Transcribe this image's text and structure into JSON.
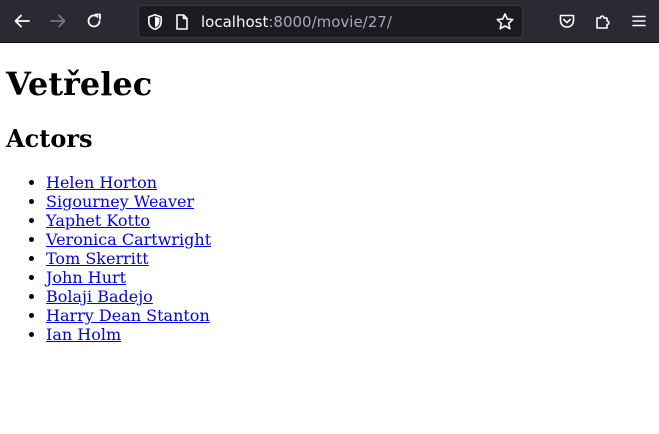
{
  "browser": {
    "url": {
      "host": "localhost",
      "path": ":8000/movie/27/"
    },
    "icons": {
      "back": "arrow-left-icon",
      "forward": "arrow-right-icon",
      "reload": "reload-icon",
      "tracking_protection": "shield-icon",
      "page_info": "page-icon",
      "bookmark": "star-icon",
      "pocket": "pocket-icon",
      "extensions": "puzzle-icon",
      "menu": "hamburger-menu-icon"
    },
    "colors": {
      "toolbar": "#2b2a33",
      "urlbar": "#1c1b22",
      "icon": "#fbfbfe",
      "icon_disabled": "#77767e"
    }
  },
  "page": {
    "title": "Vetřelec",
    "actors_heading": "Actors",
    "actors": [
      {
        "name": "Helen Horton"
      },
      {
        "name": "Sigourney Weaver"
      },
      {
        "name": "Yaphet Kotto"
      },
      {
        "name": "Veronica Cartwright"
      },
      {
        "name": "Tom Skerritt"
      },
      {
        "name": "John Hurt"
      },
      {
        "name": "Bolaji Badejo"
      },
      {
        "name": "Harry Dean Stanton"
      },
      {
        "name": "Ian Holm"
      }
    ],
    "colors": {
      "link": "#0000ee",
      "text": "#000000",
      "background": "#ffffff"
    }
  }
}
